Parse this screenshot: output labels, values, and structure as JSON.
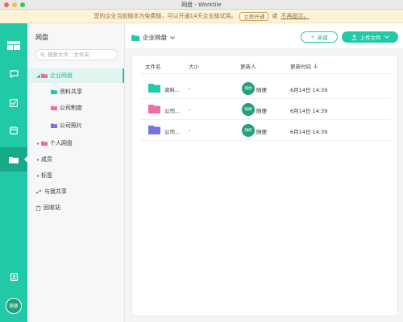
{
  "window": {
    "title": "网盘 - Worktile"
  },
  "banner": {
    "text": "您的企业当前版本为免费版，可以开通14天企业版试用。",
    "button": "立即开通",
    "or": "或",
    "dismiss": "不再提示。",
    "color": "#fdf3d9"
  },
  "rail": {
    "accent": "#22c9a6",
    "icons": [
      "apps-icon",
      "chat-icon",
      "task-icon",
      "calendar-icon",
      "folder-icon",
      "contacts-icon"
    ],
    "avatar": "随便"
  },
  "sidebar": {
    "title": "网盘",
    "search_placeholder": "搜索文件、文件夹",
    "items": [
      {
        "label": "企业网盘",
        "arrow": "◢"
      },
      {
        "label": "资料共享"
      },
      {
        "label": "公司制度"
      },
      {
        "label": "公司照片"
      },
      {
        "label": "个人网盘",
        "arrow": "▸"
      },
      {
        "label": "成员",
        "arrow": "▸"
      },
      {
        "label": "标签",
        "arrow": "▸"
      },
      {
        "label": "与我共享"
      },
      {
        "label": "回收站"
      }
    ]
  },
  "header": {
    "breadcrumb": "企业网盘",
    "new_button": "新建",
    "upload_button": "上传文件"
  },
  "table": {
    "columns": [
      "文件名",
      "大小",
      "更新人",
      "更新时间"
    ],
    "rows": [
      {
        "name": "资料...",
        "size": "-",
        "user": "随便",
        "time": "6月14日 14:39",
        "folder_color": "#22c9a6"
      },
      {
        "name": "公司...",
        "size": "-",
        "user": "随便",
        "time": "6月14日 14:39",
        "folder_color": "#f06aa6"
      },
      {
        "name": "公司...",
        "size": "-",
        "user": "随便",
        "time": "6月14日 14:39",
        "folder_color": "#7b70e0"
      }
    ]
  }
}
